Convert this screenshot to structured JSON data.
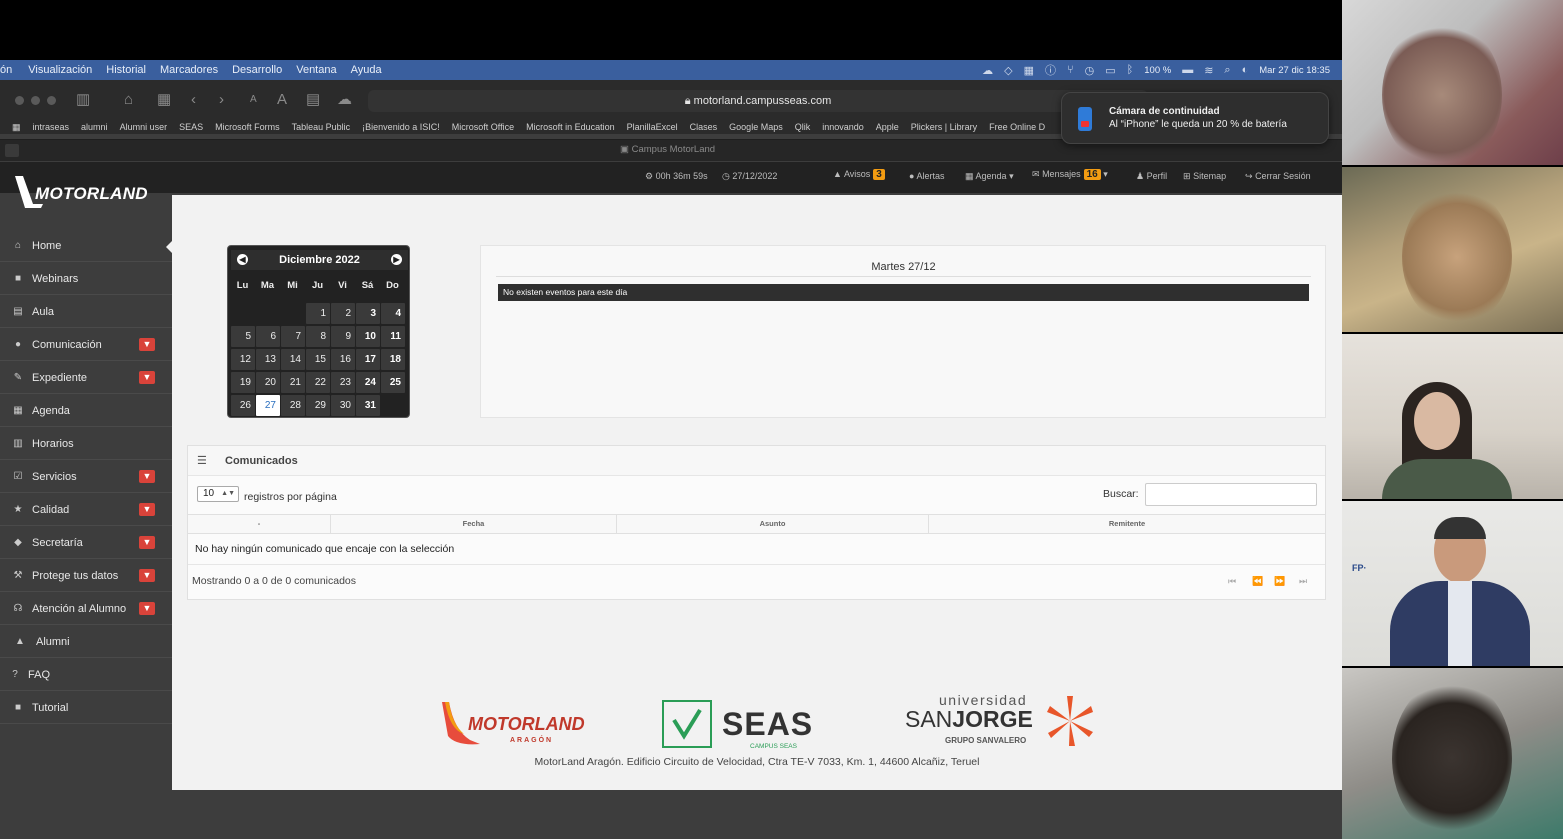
{
  "menubar": {
    "items": [
      "ón",
      "Visualización",
      "Historial",
      "Marcadores",
      "Desarrollo",
      "Ventana",
      "Ayuda"
    ],
    "battery": "100 %",
    "clock": "Mar 27 dic 18:35"
  },
  "browser": {
    "url": "motorland.campusseas.com",
    "bookmarks": [
      "intraseas",
      "alumni",
      "Alumni user",
      "SEAS",
      "Microsoft Forms",
      "Tableau Public",
      "¡Bienvenido a ISIC!",
      "Microsoft Office",
      "Microsoft in Education",
      "PlanillaExcel",
      "Clases",
      "Google Maps",
      "Qlik",
      "innovando",
      "Apple",
      "Plickers | Library",
      "Free Online D"
    ],
    "tab_title": "Campus MotorLand"
  },
  "notification": {
    "title": "Cámara de continuidad",
    "body": "Al “iPhone” le queda un 20 % de batería"
  },
  "header": {
    "logo": "MOTORLAND",
    "session_time": "00h 36m 59s",
    "date": "27/12/2022",
    "avisos_label": "Avisos",
    "avisos_count": "3",
    "alertas_label": "Alertas",
    "agenda_label": "Agenda",
    "mensajes_label": "Mensajes",
    "mensajes_count": "16",
    "perfil_label": "Perfil",
    "sitemap_label": "Sitemap",
    "logout_label": "Cerrar Sesión"
  },
  "sidebar": {
    "items": [
      {
        "label": "Home",
        "icon": "home-icon",
        "expand": false
      },
      {
        "label": "Webinars",
        "icon": "video-icon",
        "expand": false
      },
      {
        "label": "Aula",
        "icon": "classroom-icon",
        "expand": false
      },
      {
        "label": "Comunicación",
        "icon": "chat-icon",
        "expand": true
      },
      {
        "label": "Expediente",
        "icon": "pencil-icon",
        "expand": true
      },
      {
        "label": "Agenda",
        "icon": "grid-icon",
        "expand": false
      },
      {
        "label": "Horarios",
        "icon": "calendar-icon",
        "expand": false
      },
      {
        "label": "Servicios",
        "icon": "check-square-icon",
        "expand": true
      },
      {
        "label": "Calidad",
        "icon": "star-icon",
        "expand": true
      },
      {
        "label": "Secretaría",
        "icon": "tag-icon",
        "expand": true
      },
      {
        "label": "Protege tus datos",
        "icon": "gavel-icon",
        "expand": true
      },
      {
        "label": "Atención al Alumno",
        "icon": "headset-icon",
        "expand": true
      },
      {
        "label": "Alumni",
        "icon": "graduation-icon",
        "expand": false
      },
      {
        "label": "FAQ",
        "icon": "question-icon",
        "expand": false
      },
      {
        "label": "Tutorial",
        "icon": "video-icon",
        "expand": false
      }
    ]
  },
  "calendar": {
    "month": "Diciembre 2022",
    "weekdays": [
      "Lu",
      "Ma",
      "Mi",
      "Ju",
      "Vi",
      "Sá",
      "Do"
    ],
    "today": "27"
  },
  "events": {
    "title": "Martes 27/12",
    "empty": "No existen eventos para este día"
  },
  "comunicados": {
    "title": "Comunicados",
    "page_size": "10",
    "per_page_label": "registros por página",
    "search_label": "Buscar:",
    "columns": [
      "-",
      "Fecha",
      "Asunto",
      "Remitente"
    ],
    "empty": "No hay ningún comunicado que encaje con la selección",
    "summary": "Mostrando 0 a 0 de 0 comunicados"
  },
  "footer": {
    "motorland": "MOTORLAND",
    "motorland_sub": "ARAGÓN",
    "seas": "SEAS",
    "seas_sub": "CAMPUS SEAS",
    "usj_top": "universidad",
    "usj_san": "SAN",
    "usj_jorge": "JORGE",
    "usj_sub": "GRUPO SANVALERO",
    "address": "MotorLand Aragón. Edificio Circuito de Velocidad, Ctra TE-V 7033, Km. 1, 44600 Alcañiz, Teruel"
  },
  "colors": {
    "accent_orange": "#f39c12",
    "expand_red": "#d9433a",
    "menubar_blue": "#3a5f9e",
    "seas_green": "#2a9d56"
  }
}
